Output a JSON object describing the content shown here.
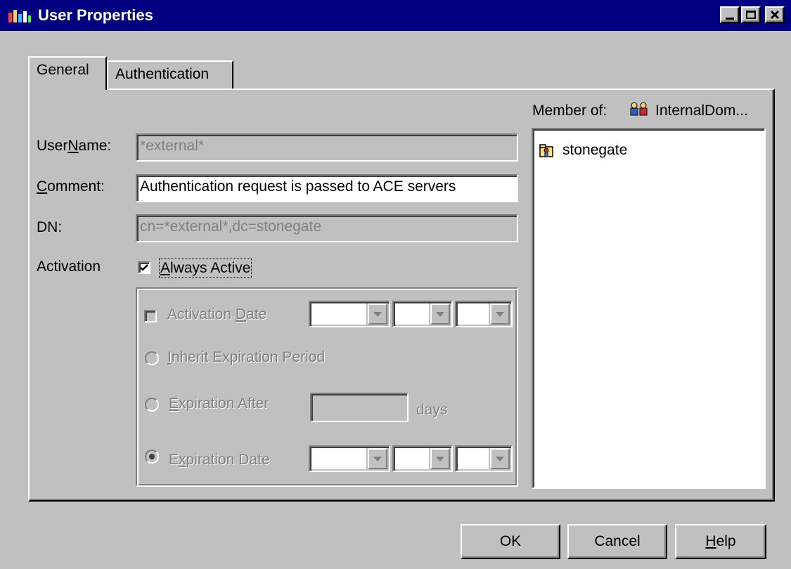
{
  "window": {
    "title": "User Properties",
    "icon": "user-properties-icon",
    "controls": {
      "minimize": "_",
      "maximize": "□",
      "close": "✕"
    }
  },
  "tabs": [
    {
      "label": "General",
      "active": true
    },
    {
      "label": "Authentication",
      "active": false
    }
  ],
  "form": {
    "username": {
      "label_pre": "User",
      "label_ul": "N",
      "label_post": "ame:",
      "value": "*external*",
      "enabled": false
    },
    "comment": {
      "label_pre": "",
      "label_ul": "C",
      "label_post": "omment:",
      "value": "Authentication request is passed to ACE servers",
      "enabled": true
    },
    "dn": {
      "label": "DN:",
      "value": "cn=*external*,dc=stonegate",
      "enabled": false
    },
    "activation": {
      "label": "Activation",
      "always_active": {
        "label_pre": "",
        "label_ul": "A",
        "label_post": "lways Active",
        "checked": true
      },
      "activation_date": {
        "label_pre": "Activation ",
        "label_ul": "D",
        "label_post": "ate",
        "checked": false,
        "enabled": false
      },
      "inherit_expiration": {
        "label_pre": "",
        "label_ul": "I",
        "label_post": "nherit Expiration Period",
        "selected": false
      },
      "expiration_after": {
        "label_pre": "",
        "label_ul": "E",
        "label_post": "xpiration After",
        "selected": false,
        "value": "",
        "unit": "days"
      },
      "expiration_date": {
        "label_pre": "E",
        "label_ul": "x",
        "label_post": "piration Date",
        "selected": true
      }
    }
  },
  "member_of": {
    "label": "Member of:",
    "domain": "InternalDom...",
    "domain_icon": "users-group-icon",
    "items": [
      {
        "name": "stonegate",
        "icon": "group-folder-icon"
      }
    ]
  },
  "buttons": {
    "ok": "OK",
    "cancel": "Cancel",
    "help_ul": "H",
    "help_post": "elp"
  },
  "colors": {
    "titlebar": "#000080",
    "face": "#c0c0c0",
    "disabled_text": "#808080"
  }
}
